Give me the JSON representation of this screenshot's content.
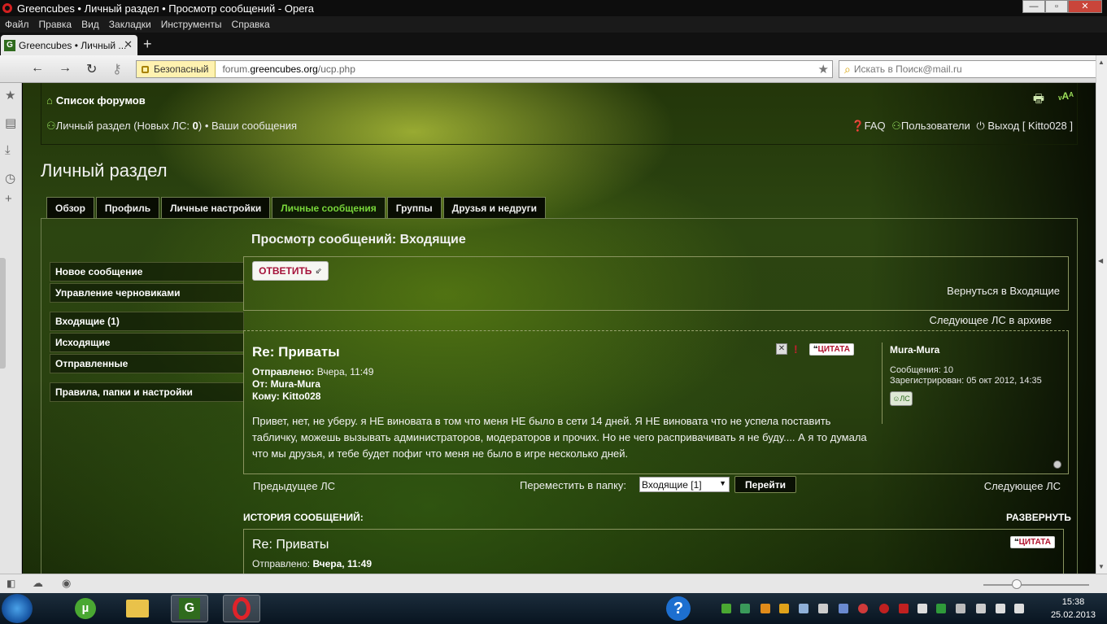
{
  "window": {
    "title": "Greencubes • Личный раздел • Просмотр сообщений - Opera",
    "minimize": "—",
    "maximize": "▫",
    "close": "✕"
  },
  "menubar": [
    "Файл",
    "Правка",
    "Вид",
    "Закладки",
    "Инструменты",
    "Справка"
  ],
  "tab": {
    "favicon": "G",
    "title": "Greencubes • Личный ...",
    "close": "✕",
    "new_tab": "+"
  },
  "addressbar": {
    "security_label": "Безопасный",
    "url_prefix": "forum.",
    "url_domain": "greencubes.org",
    "url_path": "/ucp.php",
    "search_placeholder": "Искать в Поиск@mail.ru",
    "nav_icons": {
      "back": "←",
      "forward": "→",
      "reload": "↻",
      "key": "⚷",
      "star": "★",
      "search": "⌕"
    }
  },
  "sidepanel_icons": [
    "★",
    "▤",
    "⤓",
    "◷",
    "+"
  ],
  "header": {
    "forums_link": "Список форумов",
    "breadcrumb_section": "Личный раздел (Новых ЛС: ",
    "breadcrumb_count": "0",
    "breadcrumb_close": ")",
    "breadcrumb_sep": " • ",
    "breadcrumb_current": "Ваши сообщения",
    "faq": "FAQ",
    "users": "Пользователи",
    "logout": "Выход [ Kitto028 ]",
    "print_icon": "🖶",
    "fontsize_icon": "ᵥAᴬ"
  },
  "page_title": "Личный раздел",
  "nav_tabs": [
    {
      "label": "Обзор"
    },
    {
      "label": "Профиль"
    },
    {
      "label": "Личные настройки"
    },
    {
      "label": "Личные сообщения",
      "active": true
    },
    {
      "label": "Группы"
    },
    {
      "label": "Друзья и недруги"
    }
  ],
  "side_menu": {
    "group1": [
      "Новое сообщение",
      "Управление черновиками"
    ],
    "group2": [
      "Входящие (1)",
      "Исходящие",
      "Отправленные"
    ],
    "group3": [
      "Правила, папки и настройки"
    ]
  },
  "section_title": "Просмотр сообщений: Входящие",
  "reply_button": "ОТВЕТИТЬ",
  "back_to_inbox": "Вернуться в Входящие",
  "next_in_archive": "Следующее ЛС в архиве",
  "message": {
    "title": "Re: Приваты",
    "sent_label": "Отправлено:",
    "sent_value": "Вчера, 11:49",
    "from_label": "От:",
    "from_value": "Mura-Mura",
    "to_label": "Кому:",
    "to_value": "Kitto028",
    "body": "Привет, нет, не уберу. я НЕ виновата в том что меня НЕ было в сети 14 дней. Я НЕ виновата что не успела поставить табличку, можешь вызывать администраторов, модераторов и прочих. Но не чего распривачивать я не буду.... А я то думала что мы друзья, и тебе будет пофиг что меня не было в игре несколько дней.",
    "quote_label": "ЦИТАТА",
    "delete_icon": "✕",
    "report_icon": "!"
  },
  "author": {
    "name": "Mura-Mura",
    "posts": "Сообщения: 10",
    "registered": "Зарегистрирован: 05 окт 2012, 14:35",
    "pm_button": "ЛС"
  },
  "nav_row": {
    "prev": "Предыдущее ЛС",
    "move_label": "Переместить в папку:",
    "folder_selected": "Входящие [1]",
    "go_button": "Перейти",
    "next": "Следующее ЛС"
  },
  "history": {
    "title": "ИСТОРИЯ СООБЩЕНИЙ:",
    "expand": "РАЗВЕРНУТЬ",
    "item_title": "Re: Приваты",
    "item_sent_label": "Отправлено:",
    "item_sent_value": "Вчера, 11:49",
    "quote_label": "ЦИТАТА"
  },
  "taskbar": {
    "time": "15:38",
    "date": "25.02.2013"
  },
  "colors": {
    "accent_green": "#78d63a",
    "quote_red": "#b0102c",
    "reply_red": "#a5123a"
  }
}
